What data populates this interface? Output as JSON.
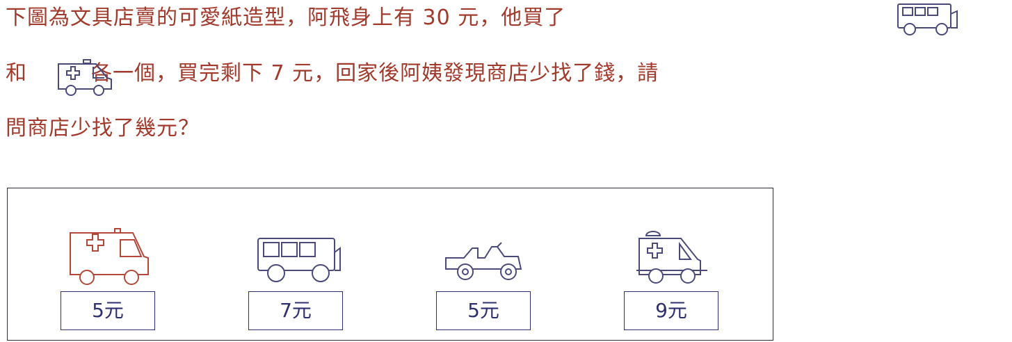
{
  "question": {
    "line1": "下圖為文具店賣的可愛紙造型，阿飛身上有 30 元，他買了",
    "line2_pre": "和",
    "line2_post": "各一個，買完剩下 7 元，回家後阿姨發現商店少找了錢，請",
    "line3": "問商店少找了幾元？"
  },
  "items": [
    {
      "icon": "ambulance-icon",
      "price": "5元"
    },
    {
      "icon": "bus-icon",
      "price": "7元"
    },
    {
      "icon": "jeep-icon",
      "price": "5元"
    },
    {
      "icon": "ambulance-small-icon",
      "price": "9元"
    }
  ],
  "colors": {
    "question_text": "#a23a2c",
    "red_icon": "#b5473a",
    "blue_icon": "#4a4a7a",
    "price_text": "#2e2f6e"
  }
}
